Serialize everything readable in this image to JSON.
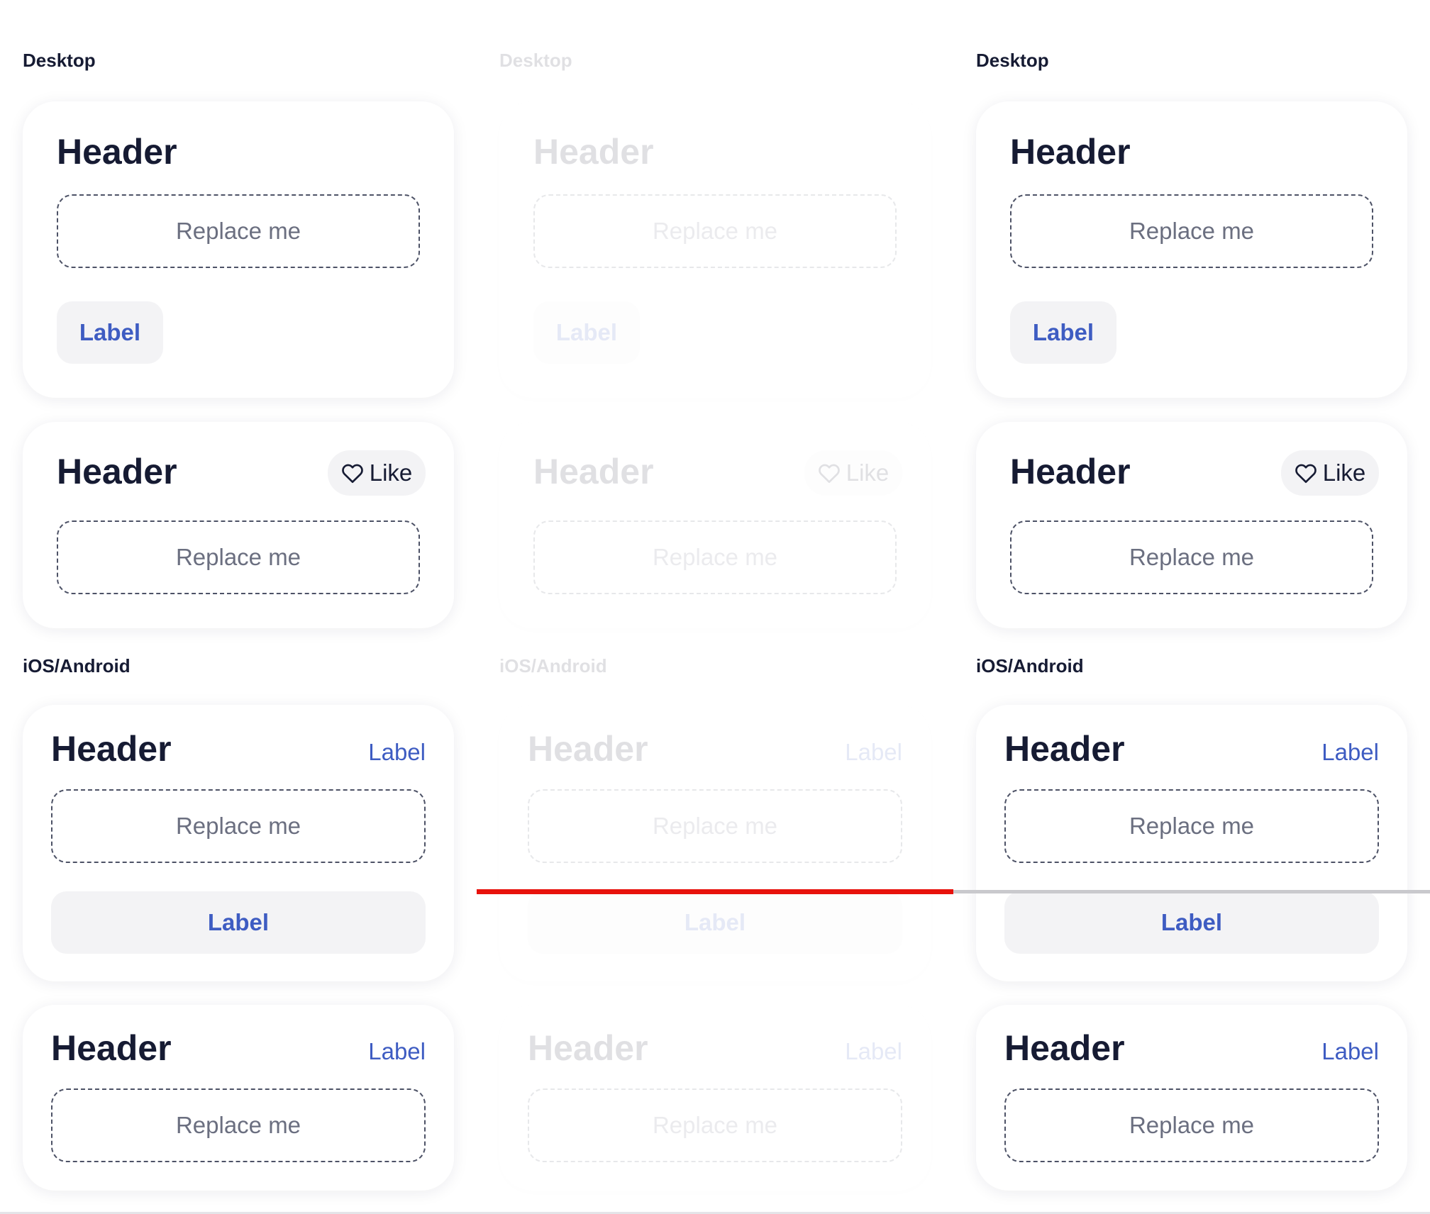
{
  "columns": [
    {
      "state": "default",
      "desktop_title": "Desktop",
      "mobile_title": "iOS/Android",
      "desktop_card_1": {
        "header": "Header",
        "placeholder": "Replace me",
        "button": "Label"
      },
      "desktop_card_2": {
        "header": "Header",
        "like": "Like",
        "placeholder": "Replace me"
      },
      "mobile_card_1": {
        "header": "Header",
        "link": "Label",
        "placeholder": "Replace me",
        "button": "Label"
      },
      "mobile_card_2": {
        "header": "Header",
        "link": "Label",
        "placeholder": "Replace me"
      }
    },
    {
      "state": "faded",
      "desktop_title": "Desktop",
      "mobile_title": "iOS/Android",
      "desktop_card_1": {
        "header": "Header",
        "placeholder": "Replace me",
        "button": "Label"
      },
      "desktop_card_2": {
        "header": "Header",
        "like": "Like",
        "placeholder": "Replace me"
      },
      "mobile_card_1": {
        "header": "Header",
        "link": "Label",
        "placeholder": "Replace me",
        "button": "Label"
      },
      "mobile_card_2": {
        "header": "Header",
        "link": "Label",
        "placeholder": "Replace me"
      }
    },
    {
      "state": "default",
      "desktop_title": "Desktop",
      "mobile_title": "iOS/Android",
      "desktop_card_1": {
        "header": "Header",
        "placeholder": "Replace me",
        "button": "Label"
      },
      "desktop_card_2": {
        "header": "Header",
        "like": "Like",
        "placeholder": "Replace me"
      },
      "mobile_card_1": {
        "header": "Header",
        "link": "Label",
        "placeholder": "Replace me",
        "button": "Label"
      },
      "mobile_card_2": {
        "header": "Header",
        "link": "Label",
        "placeholder": "Replace me"
      }
    }
  ],
  "colors": {
    "text": "#161b33",
    "accent": "#3e5cc2",
    "button_bg": "#f3f3f5",
    "divider_red": "#e8120c",
    "divider_grey": "#c9c9cd"
  },
  "icons": {
    "like": "heart-outline-icon"
  }
}
